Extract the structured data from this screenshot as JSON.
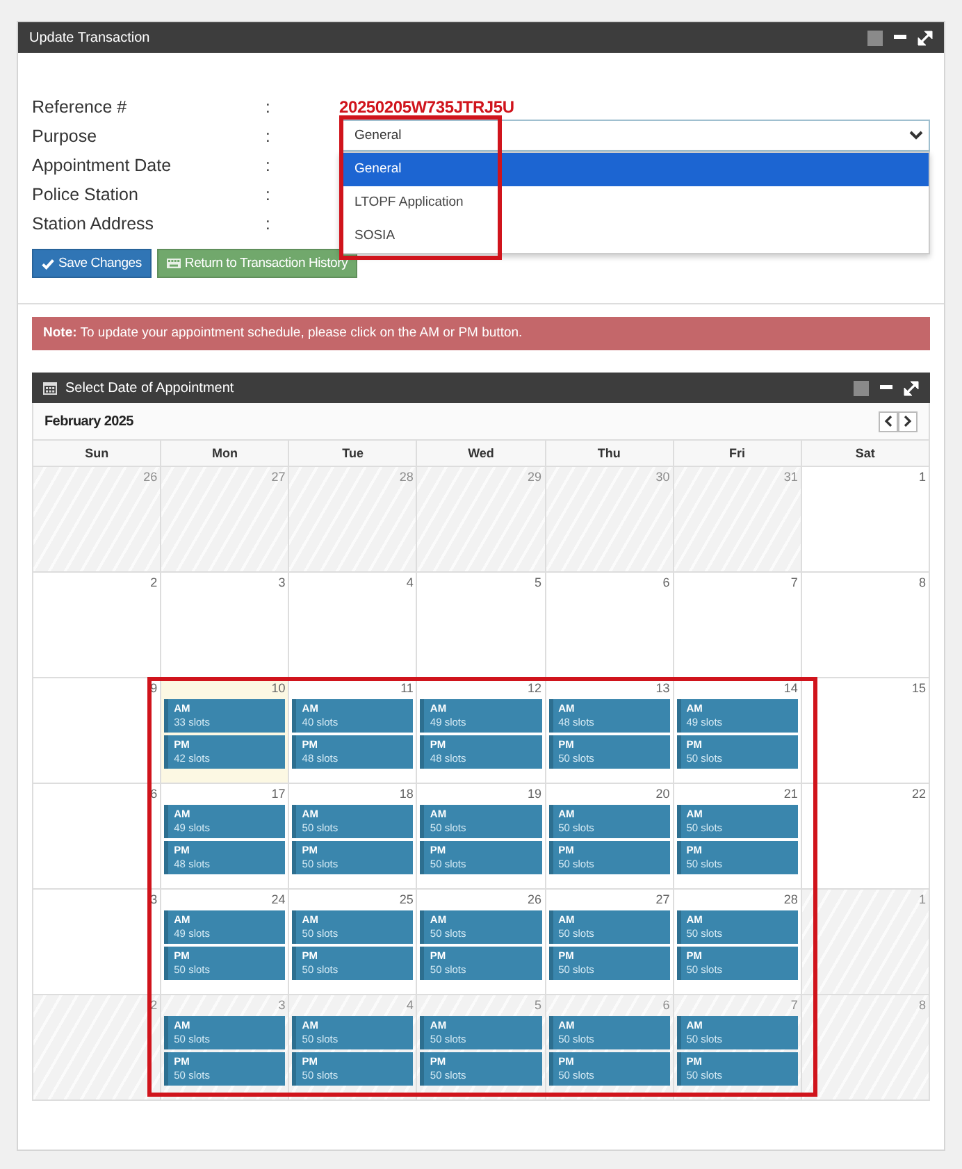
{
  "window": {
    "title": "Update Transaction"
  },
  "form": {
    "fields": [
      {
        "label": "Reference #",
        "colon": ":",
        "kind": "reference",
        "value": "20250205W735JTRJ5U"
      },
      {
        "label": "Purpose",
        "colon": ":",
        "kind": "select",
        "value": "General"
      },
      {
        "label": "Appointment Date",
        "colon": ":",
        "kind": "blank"
      },
      {
        "label": "Police Station",
        "colon": ":",
        "kind": "blank"
      },
      {
        "label": "Station Address",
        "colon": ":",
        "kind": "blank"
      }
    ]
  },
  "purpose_dropdown": {
    "expanded": true,
    "highlighted": true,
    "options": [
      {
        "label": "General",
        "selected": true
      },
      {
        "label": "LTOPF Application",
        "selected": false
      },
      {
        "label": "SOSIA",
        "selected": false
      }
    ]
  },
  "buttons": [
    {
      "label": "Save Changes",
      "kind": "save"
    },
    {
      "label": "Return to Transaction History",
      "kind": "return"
    }
  ],
  "note": {
    "text": "**Note:** To update your appointment schedule, please click on the AM or PM button."
  },
  "calendar": {
    "title": "Select Date of Appointment",
    "month": "February 2025",
    "highlighted": true,
    "weekdays": [
      "Sun",
      "Mon",
      "Tue",
      "Wed",
      "Thu",
      "Fri",
      "Sat"
    ],
    "weeks": [
      {
        "days": [
          {
            "day": "26",
            "outside": true
          },
          {
            "day": "27",
            "outside": true
          },
          {
            "day": "28",
            "outside": true
          },
          {
            "day": "29",
            "outside": true
          },
          {
            "day": "30",
            "outside": true
          },
          {
            "day": "31",
            "outside": true
          },
          {
            "day": "1",
            "outside": false
          }
        ]
      },
      {
        "days": [
          {
            "day": "2",
            "outside": false
          },
          {
            "day": "3",
            "outside": false
          },
          {
            "day": "4",
            "outside": false
          },
          {
            "day": "5",
            "outside": false
          },
          {
            "day": "6",
            "outside": false
          },
          {
            "day": "7",
            "outside": false
          },
          {
            "day": "8",
            "outside": false
          }
        ]
      },
      {
        "days": [
          {
            "day": "9",
            "outside": false
          },
          {
            "day": "10",
            "outside": false,
            "today": true,
            "slots": [
              {
                "period": "AM",
                "count": "33 slots"
              },
              {
                "period": "PM",
                "count": "42 slots"
              }
            ]
          },
          {
            "day": "11",
            "outside": false,
            "slots": [
              {
                "period": "AM",
                "count": "40 slots"
              },
              {
                "period": "PM",
                "count": "48 slots"
              }
            ]
          },
          {
            "day": "12",
            "outside": false,
            "slots": [
              {
                "period": "AM",
                "count": "49 slots"
              },
              {
                "period": "PM",
                "count": "48 slots"
              }
            ]
          },
          {
            "day": "13",
            "outside": false,
            "slots": [
              {
                "period": "AM",
                "count": "48 slots"
              },
              {
                "period": "PM",
                "count": "50 slots"
              }
            ]
          },
          {
            "day": "14",
            "outside": false,
            "slots": [
              {
                "period": "AM",
                "count": "49 slots"
              },
              {
                "period": "PM",
                "count": "50 slots"
              }
            ]
          },
          {
            "day": "15",
            "outside": false
          }
        ]
      },
      {
        "days": [
          {
            "day": "6",
            "outside": false
          },
          {
            "day": "17",
            "outside": false,
            "slots": [
              {
                "period": "AM",
                "count": "49 slots"
              },
              {
                "period": "PM",
                "count": "48 slots"
              }
            ]
          },
          {
            "day": "18",
            "outside": false,
            "slots": [
              {
                "period": "AM",
                "count": "50 slots"
              },
              {
                "period": "PM",
                "count": "50 slots"
              }
            ]
          },
          {
            "day": "19",
            "outside": false,
            "slots": [
              {
                "period": "AM",
                "count": "50 slots"
              },
              {
                "period": "PM",
                "count": "50 slots"
              }
            ]
          },
          {
            "day": "20",
            "outside": false,
            "slots": [
              {
                "period": "AM",
                "count": "50 slots"
              },
              {
                "period": "PM",
                "count": "50 slots"
              }
            ]
          },
          {
            "day": "21",
            "outside": false,
            "slots": [
              {
                "period": "AM",
                "count": "50 slots"
              },
              {
                "period": "PM",
                "count": "50 slots"
              }
            ]
          },
          {
            "day": "22",
            "outside": false
          }
        ]
      },
      {
        "days": [
          {
            "day": "3",
            "outside": false
          },
          {
            "day": "24",
            "outside": false,
            "slots": [
              {
                "period": "AM",
                "count": "49 slots"
              },
              {
                "period": "PM",
                "count": "50 slots"
              }
            ]
          },
          {
            "day": "25",
            "outside": false,
            "slots": [
              {
                "period": "AM",
                "count": "50 slots"
              },
              {
                "period": "PM",
                "count": "50 slots"
              }
            ]
          },
          {
            "day": "26",
            "outside": false,
            "slots": [
              {
                "period": "AM",
                "count": "50 slots"
              },
              {
                "period": "PM",
                "count": "50 slots"
              }
            ]
          },
          {
            "day": "27",
            "outside": false,
            "slots": [
              {
                "period": "AM",
                "count": "50 slots"
              },
              {
                "period": "PM",
                "count": "50 slots"
              }
            ]
          },
          {
            "day": "28",
            "outside": false,
            "slots": [
              {
                "period": "AM",
                "count": "50 slots"
              },
              {
                "period": "PM",
                "count": "50 slots"
              }
            ]
          },
          {
            "day": "1",
            "outside": true
          }
        ]
      },
      {
        "days": [
          {
            "day": "2",
            "outside": true
          },
          {
            "day": "3",
            "outside": true,
            "slots": [
              {
                "period": "AM",
                "count": "50 slots"
              },
              {
                "period": "PM",
                "count": "50 slots"
              }
            ]
          },
          {
            "day": "4",
            "outside": true,
            "slots": [
              {
                "period": "AM",
                "count": "50 slots"
              },
              {
                "period": "PM",
                "count": "50 slots"
              }
            ]
          },
          {
            "day": "5",
            "outside": true,
            "slots": [
              {
                "period": "AM",
                "count": "50 slots"
              },
              {
                "period": "PM",
                "count": "50 slots"
              }
            ]
          },
          {
            "day": "6",
            "outside": true,
            "slots": [
              {
                "period": "AM",
                "count": "50 slots"
              },
              {
                "period": "PM",
                "count": "50 slots"
              }
            ]
          },
          {
            "day": "7",
            "outside": true,
            "slots": [
              {
                "period": "AM",
                "count": "50 slots"
              },
              {
                "period": "PM",
                "count": "50 slots"
              }
            ]
          },
          {
            "day": "8",
            "outside": true
          }
        ]
      }
    ]
  }
}
